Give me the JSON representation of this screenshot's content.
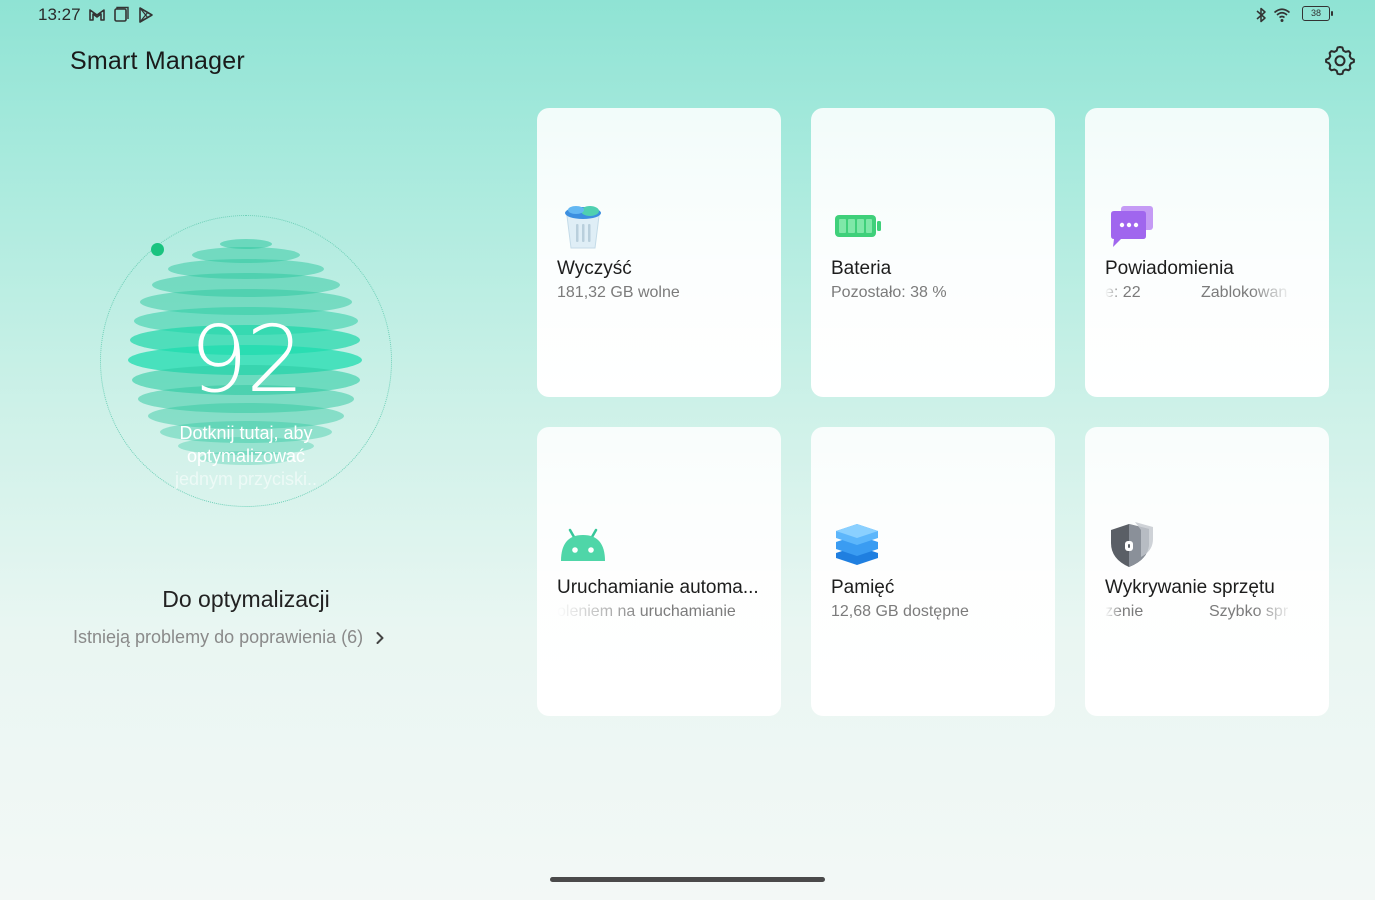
{
  "status_bar": {
    "time": "13:27",
    "battery": "38",
    "left_icons": [
      "gmail-icon",
      "tablet-icon",
      "play-store-icon"
    ],
    "right_icons": [
      "bluetooth-icon",
      "wifi-icon",
      "battery-icon"
    ]
  },
  "header": {
    "title": "Smart Manager",
    "settings_icon": "gear-icon"
  },
  "score": {
    "value": "92",
    "hint_line1": "Dotknij tutaj, aby",
    "hint_line2": "optymalizować",
    "hint_line3": "jednym przyciski..",
    "accent": "#19c37f"
  },
  "optimization": {
    "title": "Do optymalizacji",
    "subtitle": "Istnieją problemy do poprawienia (6)"
  },
  "cards": [
    {
      "title": "Wyczyść",
      "subtitle": "181,32 GB wolne",
      "icon": "trash-icon"
    },
    {
      "title": "Bateria",
      "subtitle": "Pozostało: 38 %",
      "icon": "battery-icon"
    },
    {
      "title": "Powiadomienia",
      "subtitle": "e: 22",
      "subtitle2": "Zablokowan",
      "icon": "message-icon"
    },
    {
      "title": "Uruchamianie automa...",
      "subtitle": "oleniem na uruchamianie",
      "icon": "android-icon"
    },
    {
      "title": "Pamięć",
      "subtitle": "12,68 GB dostępne",
      "icon": "memory-layers-icon"
    },
    {
      "title": "Wykrywanie sprzętu",
      "subtitle": "zenie",
      "subtitle2": "Szybko spr",
      "icon": "shield-icon"
    }
  ]
}
